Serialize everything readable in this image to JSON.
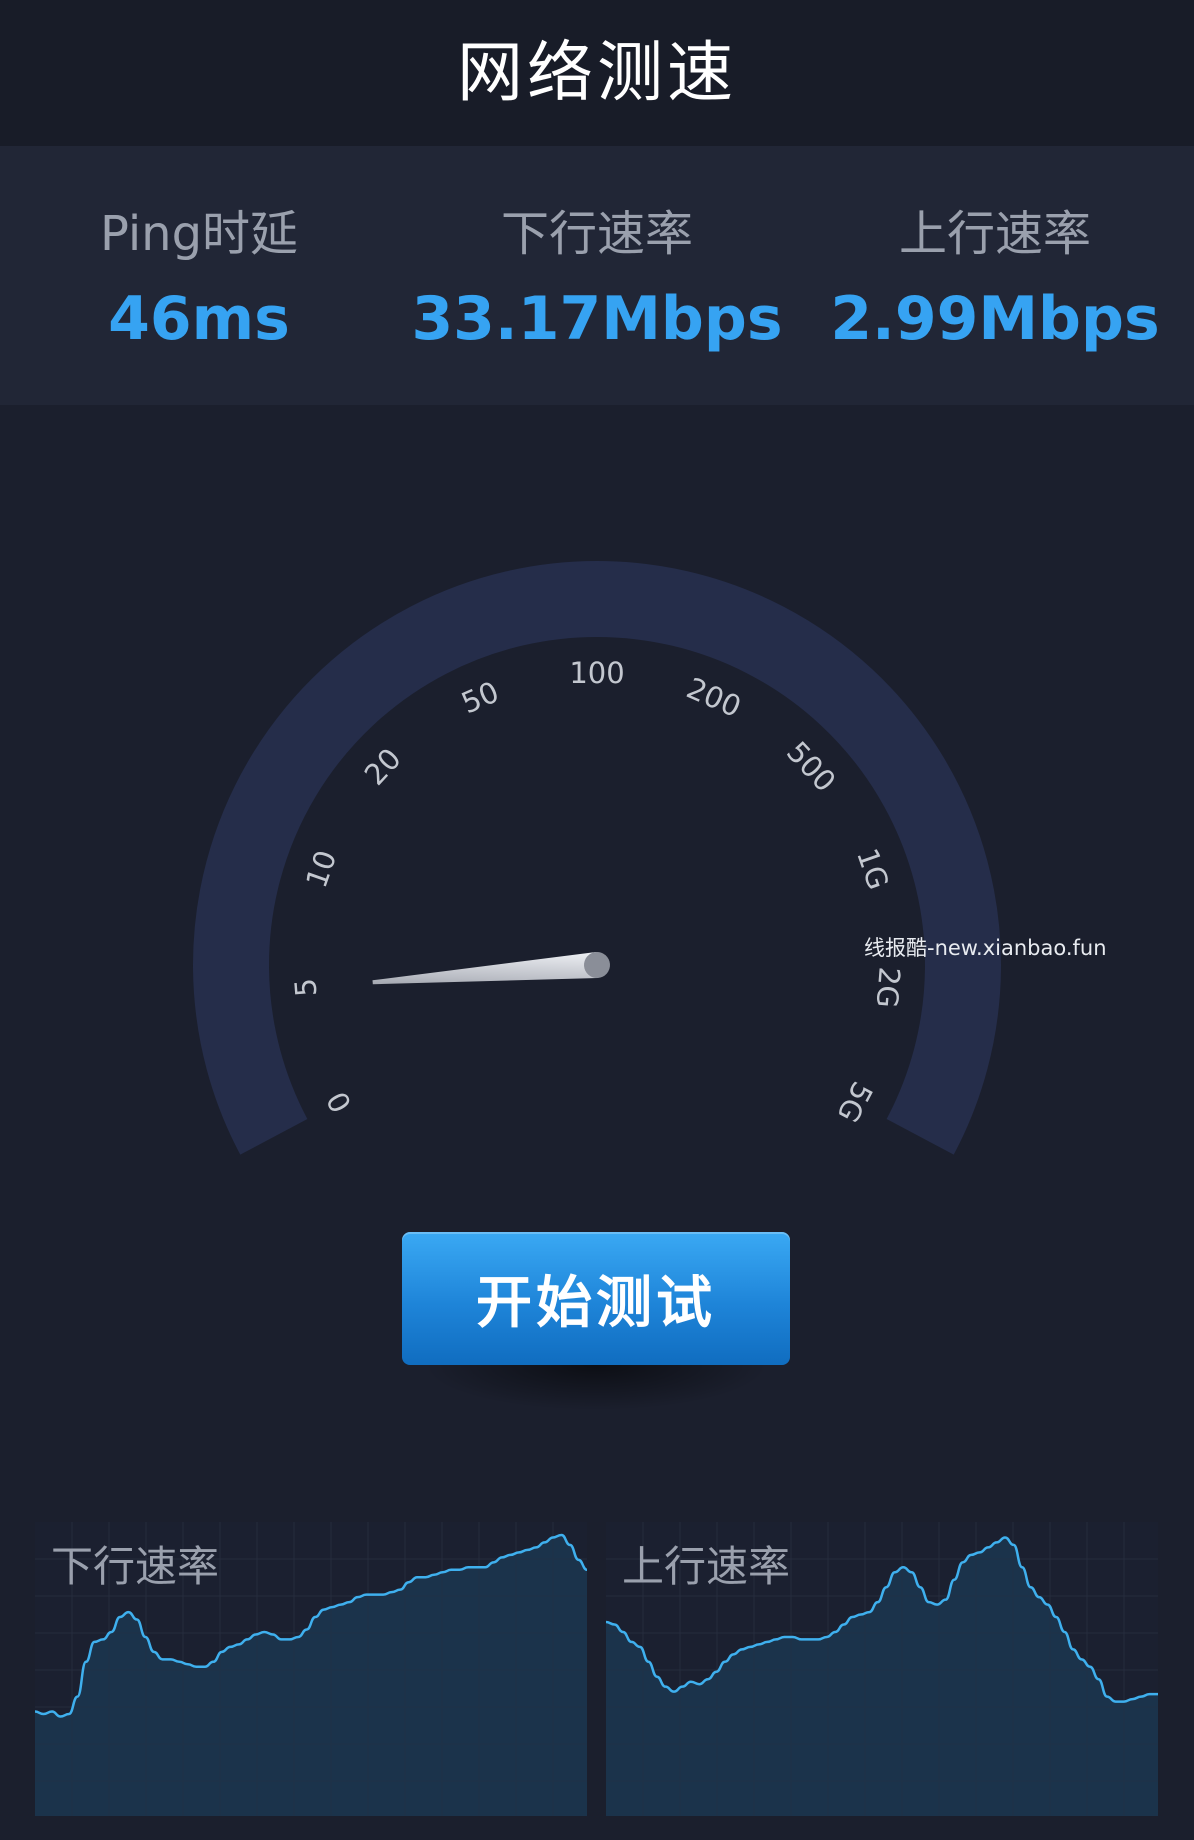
{
  "header": {
    "title": "网络测速"
  },
  "stats": [
    {
      "label": "Ping时延",
      "value": "46ms"
    },
    {
      "label": "下行速率",
      "value": "33.17Mbps"
    },
    {
      "label": "上行速率",
      "value": "2.99Mbps"
    }
  ],
  "gauge": {
    "ticks": [
      "0",
      "5",
      "10",
      "20",
      "50",
      "100",
      "200",
      "500",
      "1G",
      "2G",
      "5G"
    ],
    "needle_value": "5"
  },
  "action": {
    "start_label": "开始测试"
  },
  "graphs": {
    "download": {
      "label": "下行速率",
      "series": [
        0.42,
        0.41,
        0.42,
        0.4,
        0.41,
        0.48,
        0.62,
        0.7,
        0.71,
        0.74,
        0.8,
        0.82,
        0.79,
        0.72,
        0.66,
        0.63,
        0.63,
        0.62,
        0.61,
        0.6,
        0.6,
        0.62,
        0.66,
        0.68,
        0.69,
        0.71,
        0.73,
        0.74,
        0.73,
        0.71,
        0.71,
        0.72,
        0.75,
        0.8,
        0.83,
        0.84,
        0.85,
        0.86,
        0.88,
        0.89,
        0.89,
        0.89,
        0.9,
        0.91,
        0.94,
        0.96,
        0.96,
        0.97,
        0.98,
        0.99,
        0.99,
        1.0,
        1.0,
        1.0,
        1.02,
        1.04,
        1.05,
        1.06,
        1.07,
        1.08,
        1.1,
        1.12,
        1.13,
        1.09,
        1.03,
        0.99
      ]
    },
    "upload": {
      "label": "上行速率",
      "series": [
        0.78,
        0.77,
        0.74,
        0.7,
        0.68,
        0.62,
        0.56,
        0.52,
        0.5,
        0.52,
        0.54,
        0.53,
        0.55,
        0.58,
        0.62,
        0.65,
        0.67,
        0.68,
        0.69,
        0.7,
        0.71,
        0.72,
        0.72,
        0.71,
        0.71,
        0.71,
        0.72,
        0.74,
        0.77,
        0.8,
        0.81,
        0.82,
        0.86,
        0.92,
        0.98,
        1.0,
        0.98,
        0.92,
        0.86,
        0.85,
        0.87,
        0.95,
        1.02,
        1.05,
        1.06,
        1.08,
        1.1,
        1.12,
        1.09,
        1.0,
        0.92,
        0.88,
        0.85,
        0.8,
        0.74,
        0.67,
        0.63,
        0.6,
        0.55,
        0.48,
        0.46,
        0.46,
        0.47,
        0.48,
        0.49,
        0.49
      ]
    }
  },
  "watermark": "线报酷-new.xianbao.fun",
  "colors": {
    "accent": "#36a3f2",
    "background": "#1b1f2d",
    "gauge_track": "#252d4a",
    "graph_line": "#3fb0ee",
    "graph_fill": "#1b3750"
  }
}
